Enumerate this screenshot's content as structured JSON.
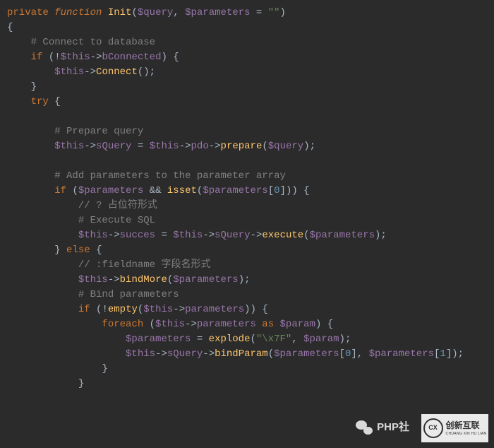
{
  "code": {
    "l1_private": "private",
    "l1_function": "function",
    "l1_name": "Init",
    "l1_p1": "$query",
    "l1_p2": "$parameters",
    "l1_def": "\"\"",
    "c_connectdb": "# Connect to database",
    "l_if": "if",
    "l_this": "$this",
    "l_bConnected": "bConnected",
    "l_Connect": "Connect",
    "l_try": "try",
    "c_prepq": "# Prepare query",
    "l_sQuery": "sQuery",
    "l_pdo": "pdo",
    "l_prepare": "prepare",
    "l_query": "$query",
    "c_addparams": "# Add parameters to the parameter array",
    "l_parameters_var": "$parameters",
    "l_isset": "isset",
    "n0": "0",
    "n1": "1",
    "c_phform": "// ? 占位符形式",
    "c_execsql": "# Execute SQL",
    "l_succes": "succes",
    "l_execute": "execute",
    "l_else": "else",
    "c_fieldname": "// :fieldname 字段名形式",
    "l_bindMore": "bindMore",
    "c_bindparams": "# Bind parameters",
    "l_empty": "empty",
    "l_parameters_prop": "parameters",
    "l_foreach": "foreach",
    "l_as": "as",
    "l_param": "$param",
    "l_explode": "explode",
    "s_x7f": "\"\\x7F\"",
    "l_bindParam": "bindParam"
  },
  "watermark": {
    "wechat_label": "PHP社",
    "logo_text": "创新互联",
    "logo_sub": "CHUANG XIN HU LIAN",
    "logo_badge": "CX"
  }
}
